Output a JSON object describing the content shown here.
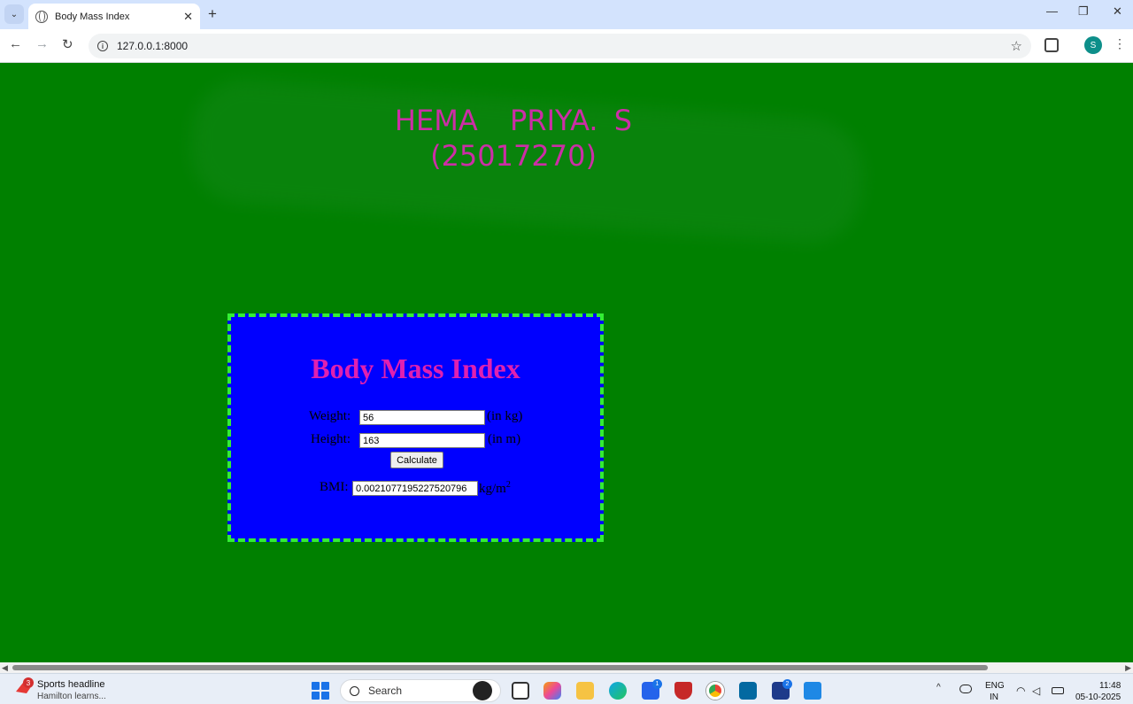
{
  "browser": {
    "tab_title": "Body Mass Index",
    "tab_close": "✕",
    "new_tab": "+",
    "url": "127.0.0.1:8000",
    "profile_initial": "S",
    "back": "←",
    "forward": "→",
    "reload": "↻",
    "star": "☆",
    "menu": "⋮",
    "minimize": "—",
    "restore": "❐",
    "close": "✕"
  },
  "page": {
    "heading_name": "HEMA  PRIYA. S",
    "heading_id": "(25017270)",
    "form": {
      "title": "Body Mass Index",
      "weight_label": "Weight:",
      "weight_value": "56",
      "weight_unit": "(in kg)",
      "height_label": "Height:",
      "height_value": "163",
      "height_unit": "(in m)",
      "calculate_label": "Calculate",
      "bmi_label": "BMI:",
      "bmi_value": "0.0021077195227520796",
      "bmi_unit": "kg/m",
      "bmi_unit_sup": "2"
    }
  },
  "taskbar": {
    "news_badge": "3",
    "news_title": "Sports headline",
    "news_sub": "Hamilton learns...",
    "search_placeholder": "Search",
    "badge_store": "1",
    "badge_l": "2",
    "lang_line1": "ENG",
    "lang_line2": "IN",
    "time": "11:48",
    "date": "05-10-2025"
  },
  "colors": {
    "page_bg": "#008000",
    "heading": "#cc2ea6",
    "box_bg": "#0000ff",
    "box_border": "#33ee33",
    "form_title": "#e020b0"
  }
}
